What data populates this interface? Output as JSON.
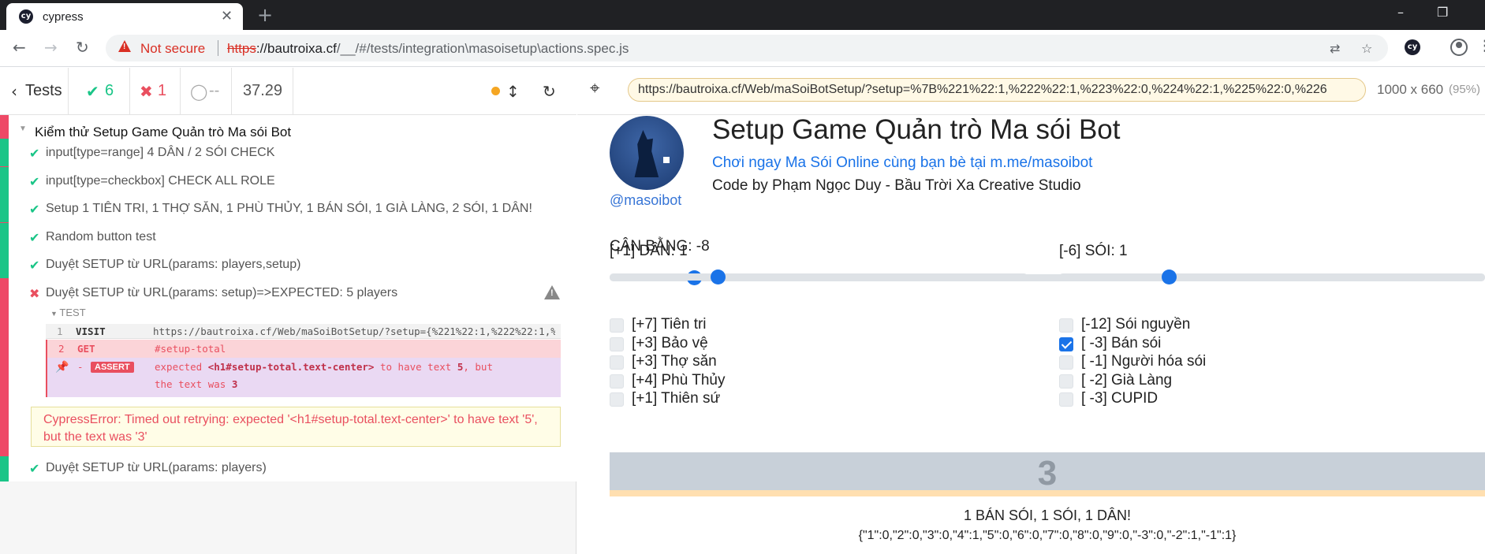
{
  "browser": {
    "tab_title": "cypress",
    "favicon_text": "cy",
    "not_secure": "Not secure",
    "url_scheme": "https",
    "url_host": "://bautroixa.cf",
    "url_path": "/__/#/tests/integration\\masoisetup\\actions.spec.js"
  },
  "reporter": {
    "tests_label": "Tests",
    "passed": "6",
    "failed": "1",
    "pending": "--",
    "duration": "37.29",
    "suite_title": "Kiểm thử Setup Game Quản trò Ma sói Bot",
    "tests": [
      {
        "state": "passed",
        "title": "input[type=range] 4 DÂN / 2 SÓI CHECK"
      },
      {
        "state": "passed",
        "title": "input[type=checkbox] CHECK ALL ROLE"
      },
      {
        "state": "passed",
        "title": "Setup 1 TIÊN TRI, 1 THỢ SĂN, 1 PHÙ THỦY, 1 BÁN SÓI, 1 GIÀ LÀNG, 2 SÓI, 1 DÂN!"
      },
      {
        "state": "passed",
        "title": "Random button test"
      },
      {
        "state": "passed",
        "title": "Duyệt SETUP từ URL(params: players,setup)"
      },
      {
        "state": "failed",
        "title": "Duyệt SETUP từ URL(params: setup)=>EXPECTED: 5 players"
      },
      {
        "state": "passed",
        "title": "Duyệt SETUP từ URL(params: players)"
      }
    ],
    "test_header": "TEST",
    "commands": [
      {
        "num": "1",
        "name": "VISIT",
        "message": "https://bautroixa.cf/Web/maSoiBotSetup/?setup={%221%22:1,%222%22:1,%223%22:0,%224%22:1,%225%22:0,%226"
      },
      {
        "num": "2",
        "name": "GET",
        "message": "#setup-total"
      },
      {
        "num": "-",
        "name": "ASSERT",
        "message_parts": [
          "expected ",
          "<h1#setup-total.text-center>",
          " to have text ",
          "5",
          ", but"
        ],
        "message_line2_parts": [
          "the text was ",
          "3"
        ]
      }
    ],
    "error": "CypressError: Timed out retrying: expected '<h1#setup-total.text-center>' to have text '5', but the text was '3'"
  },
  "aut": {
    "url": "https://bautroixa.cf/Web/maSoiBotSetup/?setup=%7B%221%22:1,%222%22:1,%223%22:0,%224%22:1,%225%22:0,%226",
    "viewport": "1000 x 660",
    "zoom": "(95%)"
  },
  "app": {
    "handle": "@masoibot",
    "title": "Setup Game Quản trò Ma sói Bot",
    "link": "Chơi ngay Ma Sói Online cùng bạn bè tại m.me/masoibot",
    "credit": "Code by Phạm Ngọc Duy - Bầu Trời Xa Creative Studio",
    "balance": "CÂN BẰNG: -8",
    "balance_level": 0.09,
    "villagers": {
      "label": "[+1] DÂN: 1",
      "level": 0.25
    },
    "wolves": {
      "label": "[-6] SÓI: 1",
      "level": 0.25
    },
    "left_roles": [
      {
        "label": "[+7] Tiên tri",
        "checked": false
      },
      {
        "label": "[+3] Bảo vệ",
        "checked": false
      },
      {
        "label": "[+3] Thợ săn",
        "checked": false
      },
      {
        "label": "[+4] Phù Thủy",
        "checked": false
      },
      {
        "label": "[+1] Thiên sứ",
        "checked": false
      }
    ],
    "right_roles": [
      {
        "label": "[-12] Sói nguyền",
        "checked": false
      },
      {
        "label": "[ -3] Bán sói",
        "checked": true
      },
      {
        "label": "[ -1] Người hóa sói",
        "checked": false
      },
      {
        "label": "[ -2] Già Làng",
        "checked": false
      },
      {
        "label": "[ -3] CUPID",
        "checked": false
      }
    ],
    "total": "3",
    "summary": "1 BÁN SÓI, 1 SÓI, 1 DÂN!",
    "json": "{\"1\":0,\"2\":0,\"3\":0,\"4\":1,\"5\":0,\"6\":0,\"7\":0,\"8\":0,\"9\":0,\"-3\":0,\"-2\":1,\"-1\":1}"
  }
}
